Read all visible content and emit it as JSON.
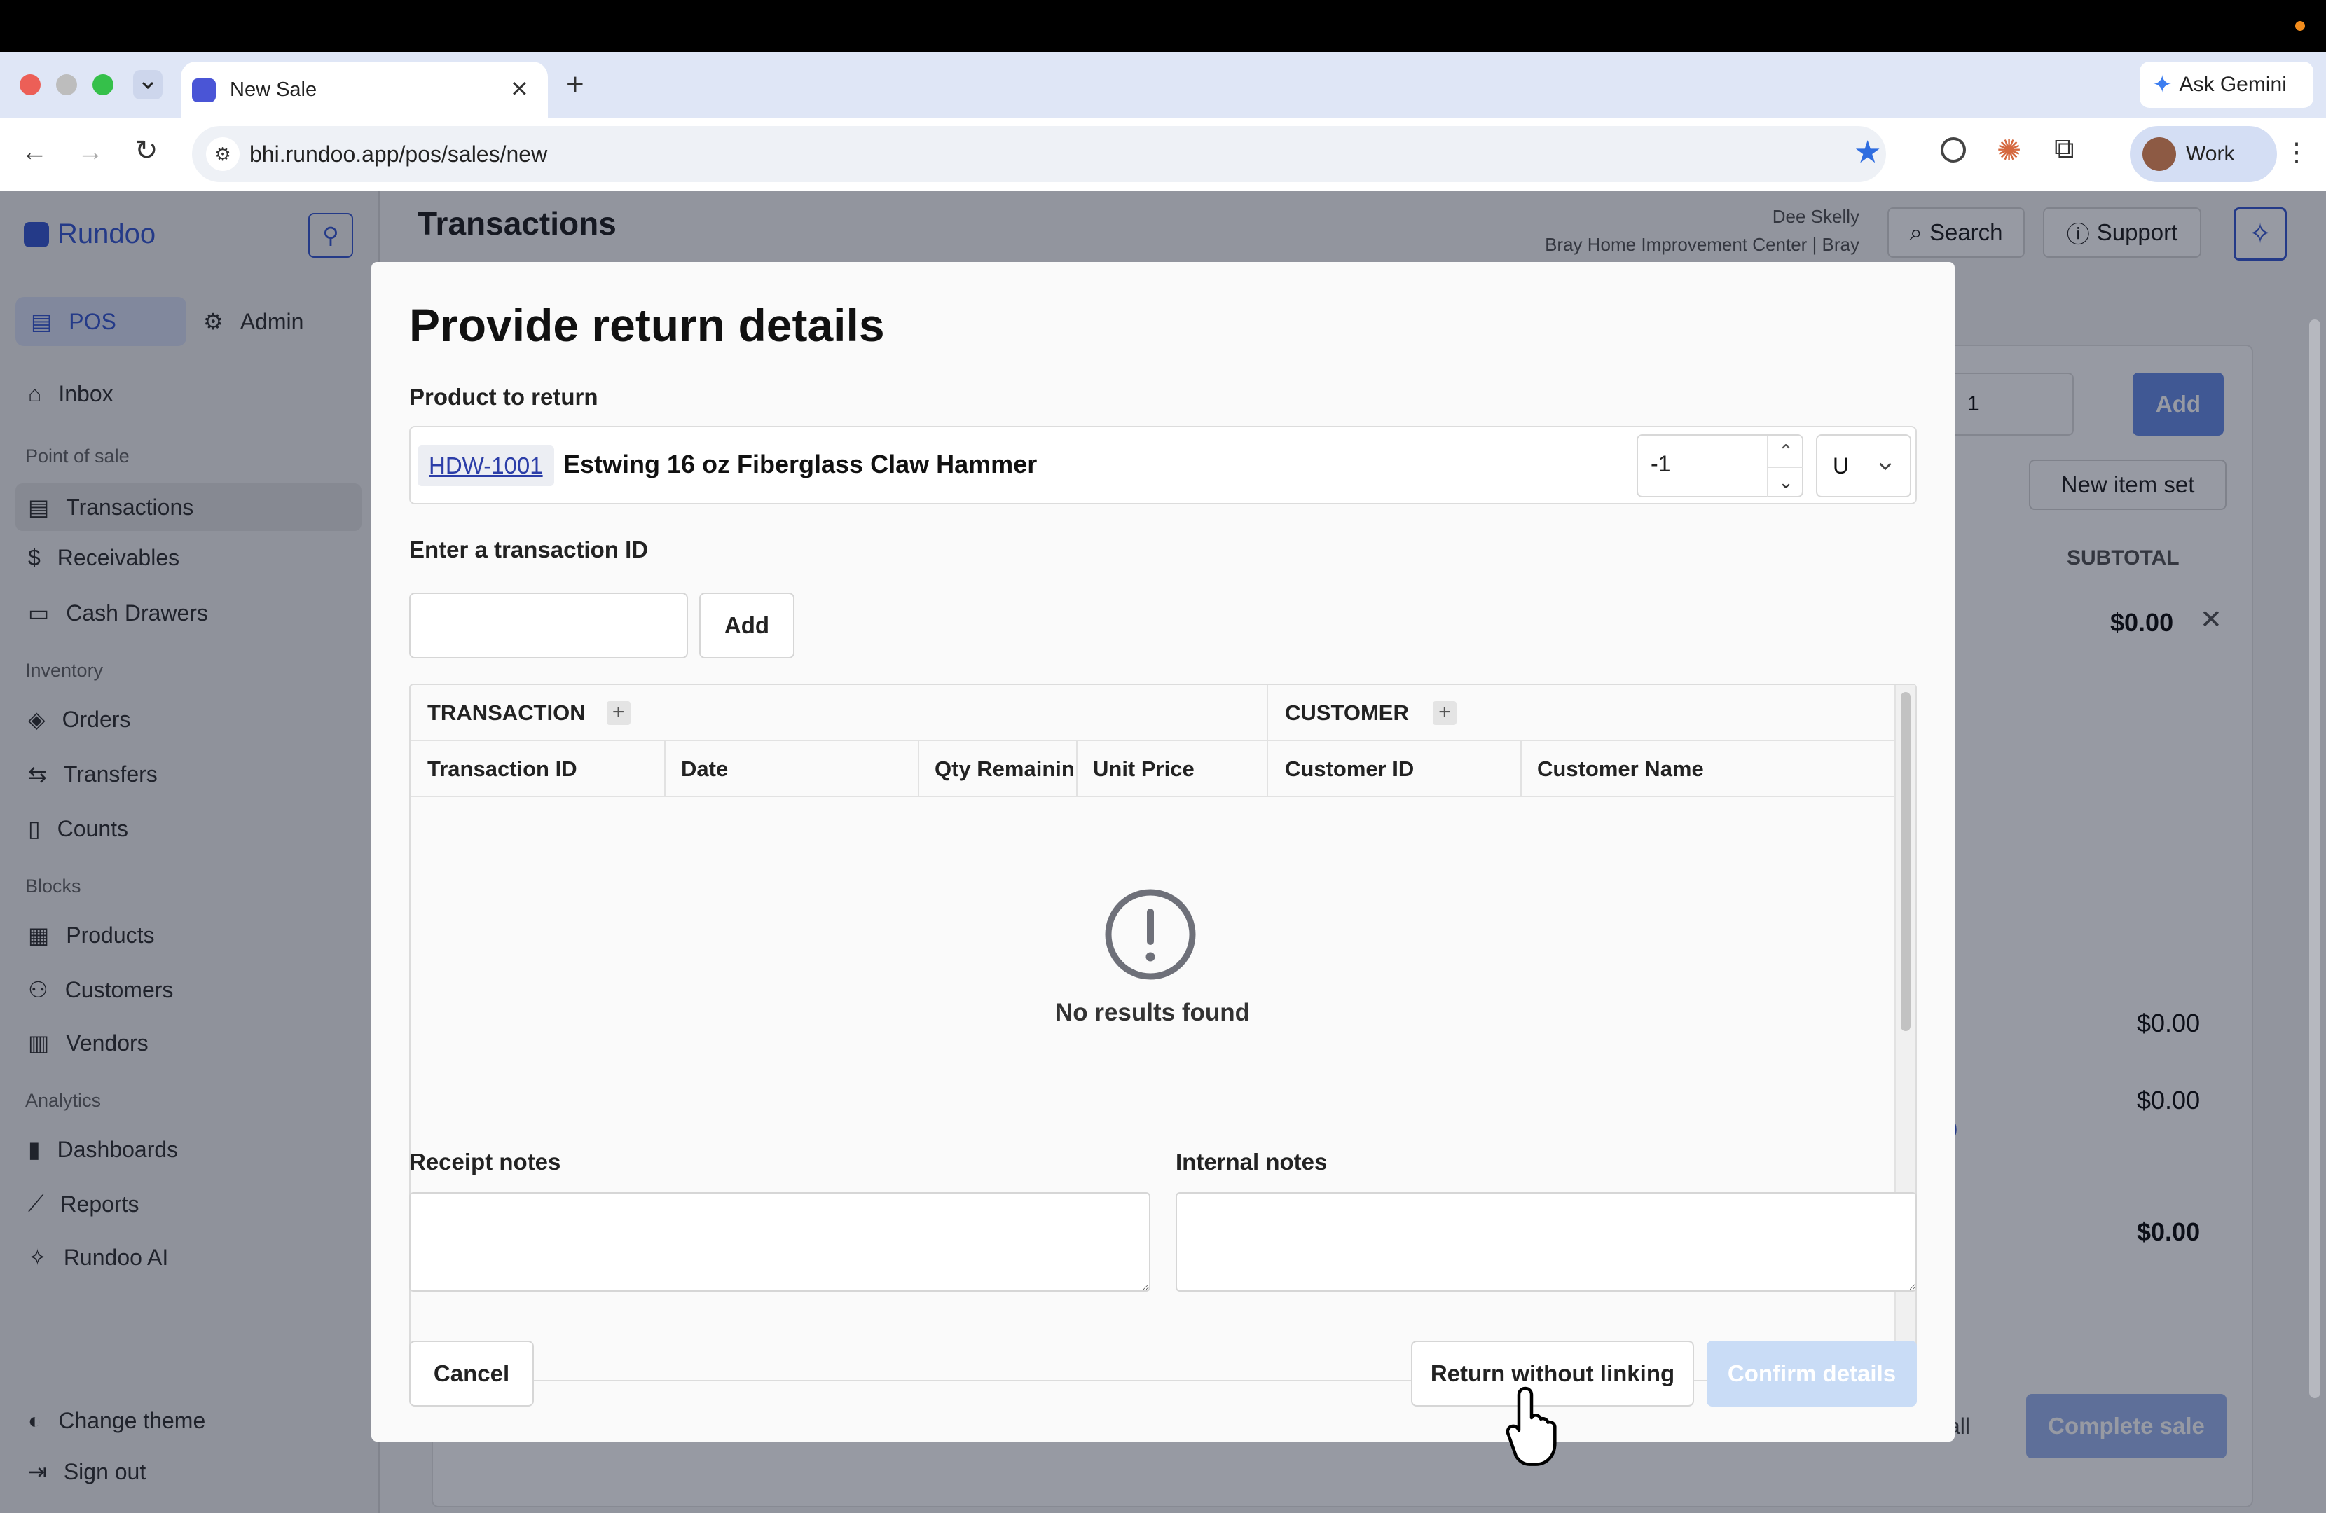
{
  "browser": {
    "tab_title": "New Sale",
    "url": "bhi.rundoo.app/pos/sales/new",
    "ask_gemini": "Ask Gemini",
    "profile": "Work"
  },
  "app": {
    "logo": "Rundoo",
    "mode_pos": "POS",
    "mode_admin": "Admin",
    "page_title": "Transactions",
    "user_name": "Dee Skelly",
    "store_name": "Bray Home Improvement Center | Bray",
    "search_label": "Search",
    "support_label": "Support"
  },
  "sidebar": {
    "inbox": "Inbox",
    "sections": [
      {
        "title": "Point of sale",
        "items": [
          "Transactions",
          "Receivables",
          "Cash Drawers"
        ]
      },
      {
        "title": "Inventory",
        "items": [
          "Orders",
          "Transfers",
          "Counts"
        ]
      },
      {
        "title": "Blocks",
        "items": [
          "Products",
          "Customers",
          "Vendors"
        ]
      },
      {
        "title": "Analytics",
        "items": [
          "Dashboards",
          "Reports",
          "Rundoo AI"
        ]
      }
    ],
    "change_theme": "Change theme",
    "sign_out": "Sign out"
  },
  "background": {
    "qty": "1",
    "add": "Add",
    "new_item_set": "New item set",
    "subtotal": "SUBTOTAL",
    "line_amount": "$0.00",
    "total1": "$0.00",
    "total2": "$0.00",
    "total3": "$0.00",
    "partial_link": ")",
    "partial_all": "all",
    "complete_sale": "Complete sale"
  },
  "modal": {
    "title": "Provide return details",
    "product_label": "Product to return",
    "sku": "HDW-1001",
    "product_name": "Estwing 16 oz Fiberglass Claw Hammer",
    "qty": "-1",
    "unit": "U",
    "txn_label": "Enter a transaction ID",
    "txn_value": "",
    "add": "Add",
    "group_transaction": "TRANSACTION",
    "group_customer": "CUSTOMER",
    "columns": [
      "Transaction ID",
      "Date",
      "Qty Remaining",
      "Unit Price",
      "Customer ID",
      "Customer Name"
    ],
    "empty": "No results found",
    "receipt_notes": "Receipt notes",
    "internal_notes": "Internal notes",
    "receipt_value": "",
    "internal_value": "",
    "cancel": "Cancel",
    "return_without": "Return without linking",
    "confirm": "Confirm details"
  },
  "colors": {
    "accent": "#3a5bd0",
    "confirm_disabled": "#c9dcf6"
  }
}
